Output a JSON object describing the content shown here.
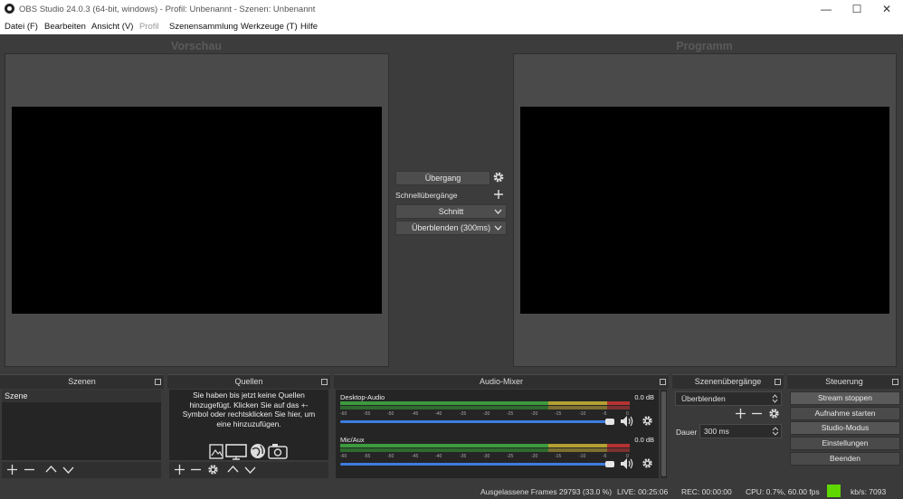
{
  "window": {
    "title": "OBS Studio 24.0.3 (64-bit, windows) - Profil: Unbenannt - Szenen: Unbenannt",
    "controls": [
      "—",
      "☐",
      "✕"
    ]
  },
  "menu": [
    "Datei (F)",
    "Bearbeiten",
    "Ansicht (V)",
    "Profil",
    "Szenensammlung",
    "Werkzeuge (T)",
    "Hilfe"
  ],
  "preview": {
    "label": "Vorschau"
  },
  "program": {
    "label": "Programm"
  },
  "transition": {
    "button": "Übergang",
    "quick_label": "Schnellübergänge",
    "cut": "Schnitt",
    "fade": "Überblenden (300ms)"
  },
  "docks": {
    "scenes": {
      "title": "Szenen",
      "items": [
        "Szene"
      ]
    },
    "sources": {
      "title": "Quellen",
      "empty_text": "Sie haben bis jetzt keine Quellen hinzugefügt. Klicken Sie auf das +-Symbol oder rechtsklicken Sie hier, um eine hinzuzufügen."
    },
    "mixer": {
      "title": "Audio-Mixer",
      "channels": [
        {
          "name": "Desktop-Audio",
          "level": "0.0 dB",
          "volume": 1.0
        },
        {
          "name": "Mic/Aux",
          "level": "0.0 dB",
          "volume": 1.0
        }
      ],
      "scale": [
        "-60",
        "-55",
        "-50",
        "-45",
        "-40",
        "-35",
        "-30",
        "-25",
        "-20",
        "-15",
        "-10",
        "-5",
        "0"
      ]
    },
    "transitions": {
      "title": "Szenenübergänge",
      "selected": "Überblenden",
      "duration_label": "Dauer",
      "duration_value": "300 ms"
    },
    "controls": {
      "title": "Steuerung",
      "buttons": [
        "Stream stoppen",
        "Aufnahme starten",
        "Studio-Modus",
        "Einstellungen",
        "Beenden"
      ]
    }
  },
  "status": {
    "dropped": "Ausgelassene Frames 29793 (33.0 %)",
    "live": "LIVE: 00:25:06",
    "rec": "REC: 00:00:00",
    "cpu": "CPU: 0.7%, 60.00 fps",
    "kbs": "kb/s: 7093",
    "indicator_color": "#5fd700"
  },
  "colors": {
    "meter_green": "#3c9b3c",
    "meter_yellow": "#b4a032",
    "meter_red": "#b43232",
    "slider": "#3d7de0"
  }
}
